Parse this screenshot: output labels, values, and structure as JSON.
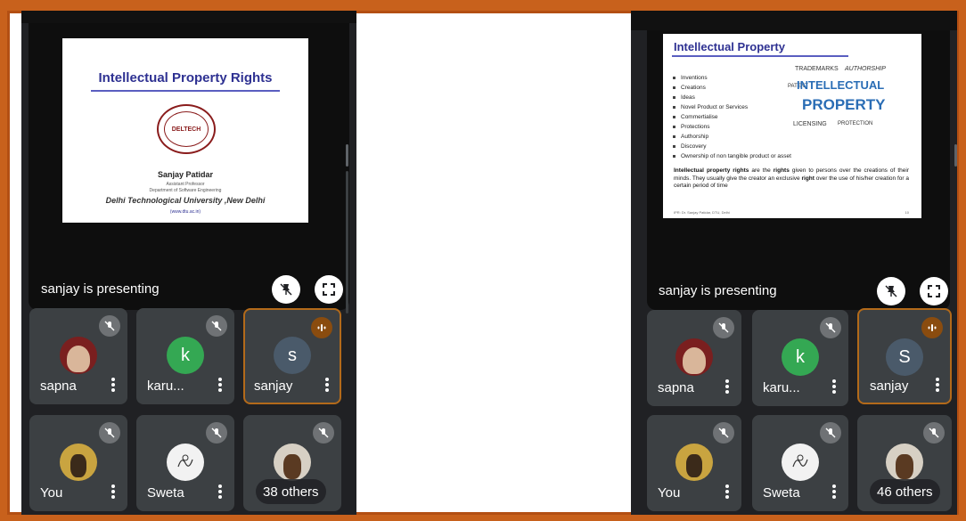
{
  "left": {
    "presenting_label": "sanjay is presenting",
    "slide": {
      "title": "Intellectual Property Rights",
      "logo_text": "DELTECH",
      "presenter_name": "Sanjay Patidar",
      "role": "Assistant Professor",
      "department": "Department of Software Engineering",
      "university": "Delhi Technological University ,New Delhi",
      "website": "(www.dtu.ac.in)"
    },
    "participants": [
      {
        "name": "sapna",
        "avatar": "photo",
        "mic": "muted"
      },
      {
        "name": "karu...",
        "avatar": "letter",
        "initial": "k",
        "color": "#34a853",
        "mic": "muted"
      },
      {
        "name": "sanjay",
        "avatar": "letter",
        "initial": "s",
        "color": "#4a5a6a",
        "mic": "speaking"
      },
      {
        "name": "You",
        "avatar": "photo",
        "mic": "muted"
      },
      {
        "name": "Sweta",
        "avatar": "sketch",
        "mic": "muted"
      },
      {
        "name": "",
        "avatar": "photo",
        "mic": "muted",
        "others": "38 others"
      }
    ]
  },
  "right": {
    "presenting_label": "sanjay is presenting",
    "slide": {
      "title": "Intellectual Property",
      "bullets": [
        "Inventions",
        "Creations",
        "Ideas",
        "Novel Product or Services",
        "Commertialise",
        "Protections",
        "Authorship",
        "Discovery",
        "Ownership of non tangible product or asset"
      ],
      "paragraph_bold1": "Intellectual property rights",
      "paragraph_rest1": " are the ",
      "paragraph_bold2": "rights",
      "paragraph_rest2": " given to persons over the creations of their minds. They usually give the creator an exclusive ",
      "paragraph_bold3": "right",
      "paragraph_rest3": " over the use of his/her creation for a certain period of time",
      "wordcloud_main1": "INTELLECTUAL",
      "wordcloud_main2": "PROPERTY",
      "wordcloud_small": [
        "TRADEMARKS",
        "AUTHORSHIP",
        "LICENSING",
        "PROTECTION",
        "PATENT"
      ],
      "footer_left": "IPR: Dr. Sanjay Patidar, DTU, Delhi",
      "footer_right": "10"
    },
    "participants": [
      {
        "name": "sapna",
        "avatar": "photo",
        "mic": "muted"
      },
      {
        "name": "karu...",
        "avatar": "letter",
        "initial": "k",
        "color": "#34a853",
        "mic": "muted"
      },
      {
        "name": "sanjay",
        "avatar": "letter",
        "initial": "S",
        "color": "#4a5a6a",
        "mic": "speaking"
      },
      {
        "name": "You",
        "avatar": "photo",
        "mic": "muted"
      },
      {
        "name": "Sweta",
        "avatar": "sketch",
        "mic": "muted"
      },
      {
        "name": "",
        "avatar": "photo",
        "mic": "muted",
        "others": "46 others"
      }
    ]
  },
  "colors": {
    "border": "#c8611c",
    "panel_bg": "#202124",
    "tile_bg": "#3c4043",
    "active_border": "#b36a1a",
    "slide_title": "#2e3192"
  }
}
